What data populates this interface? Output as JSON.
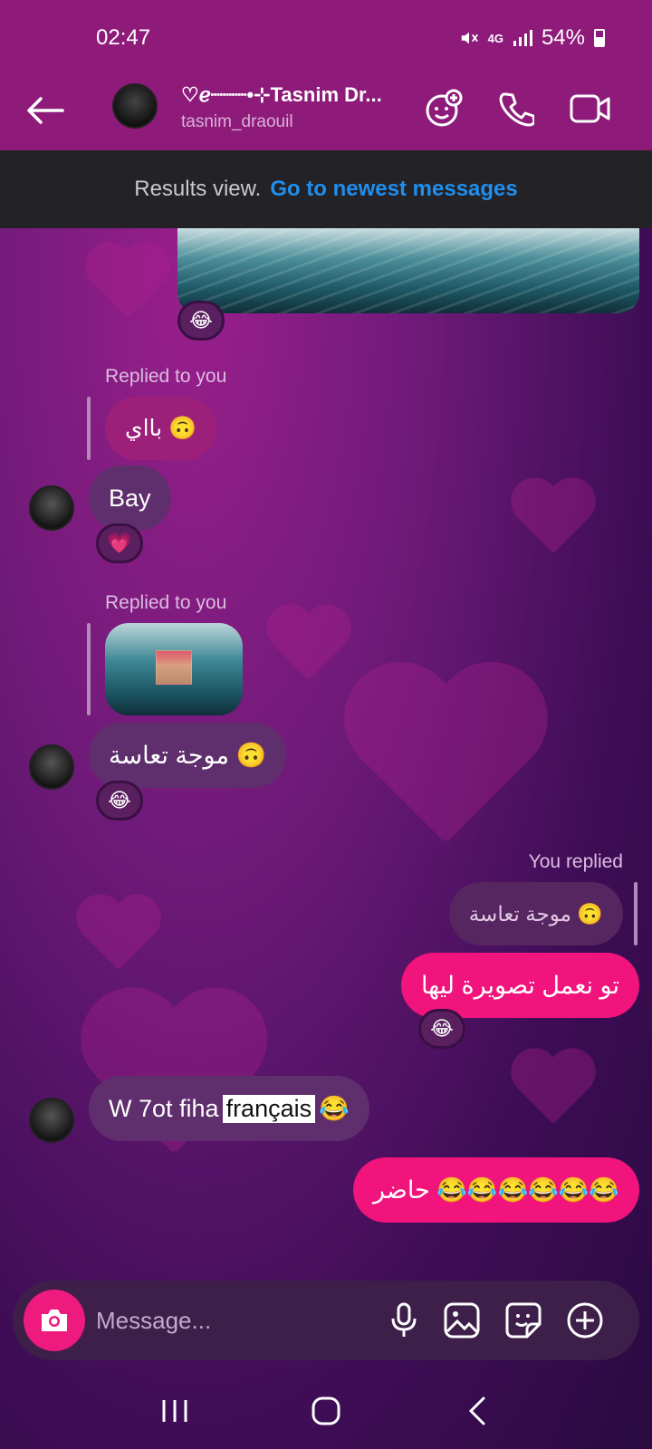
{
  "status": {
    "time": "02:47",
    "network": "4G",
    "battery": "54%"
  },
  "header": {
    "name": "♡ℯ┈┈┈•⊹Tasnim Dr...",
    "username": "tasnim_draouil",
    "icons": [
      "back-arrow-icon",
      "effects-icon",
      "phone-icon",
      "video-icon"
    ]
  },
  "results_bar": {
    "label": "Results view.",
    "link": "Go to newest messages"
  },
  "messages": {
    "reaction_1": "😂",
    "reply_1": {
      "label": "Replied to you",
      "quoted": "بااي 🙃",
      "text": "Bay",
      "reaction": "💗"
    },
    "reply_2": {
      "label": "Replied to you",
      "text": "موجة تعاسة 🙃",
      "reaction": "😂"
    },
    "reply_3": {
      "label": "You replied",
      "quoted": "موجة تعاسة 🙃",
      "text": "تو نعمل تصويرة ليها",
      "reaction": "😂"
    },
    "msg_4": {
      "before": "W 7ot fiha",
      "highlight": "français",
      "after": "😂"
    },
    "msg_5": "حاضر 😂😂😂😂😂😂"
  },
  "composer": {
    "placeholder": "Message...",
    "icons": [
      "camera-icon",
      "mic-icon",
      "gallery-icon",
      "sticker-icon",
      "plus-icon"
    ]
  },
  "colors": {
    "header_bg": "#8e1a7a",
    "my_bubble": "#f0147c",
    "their_bubble": "#5e2f6c",
    "link": "#1f8fef"
  }
}
